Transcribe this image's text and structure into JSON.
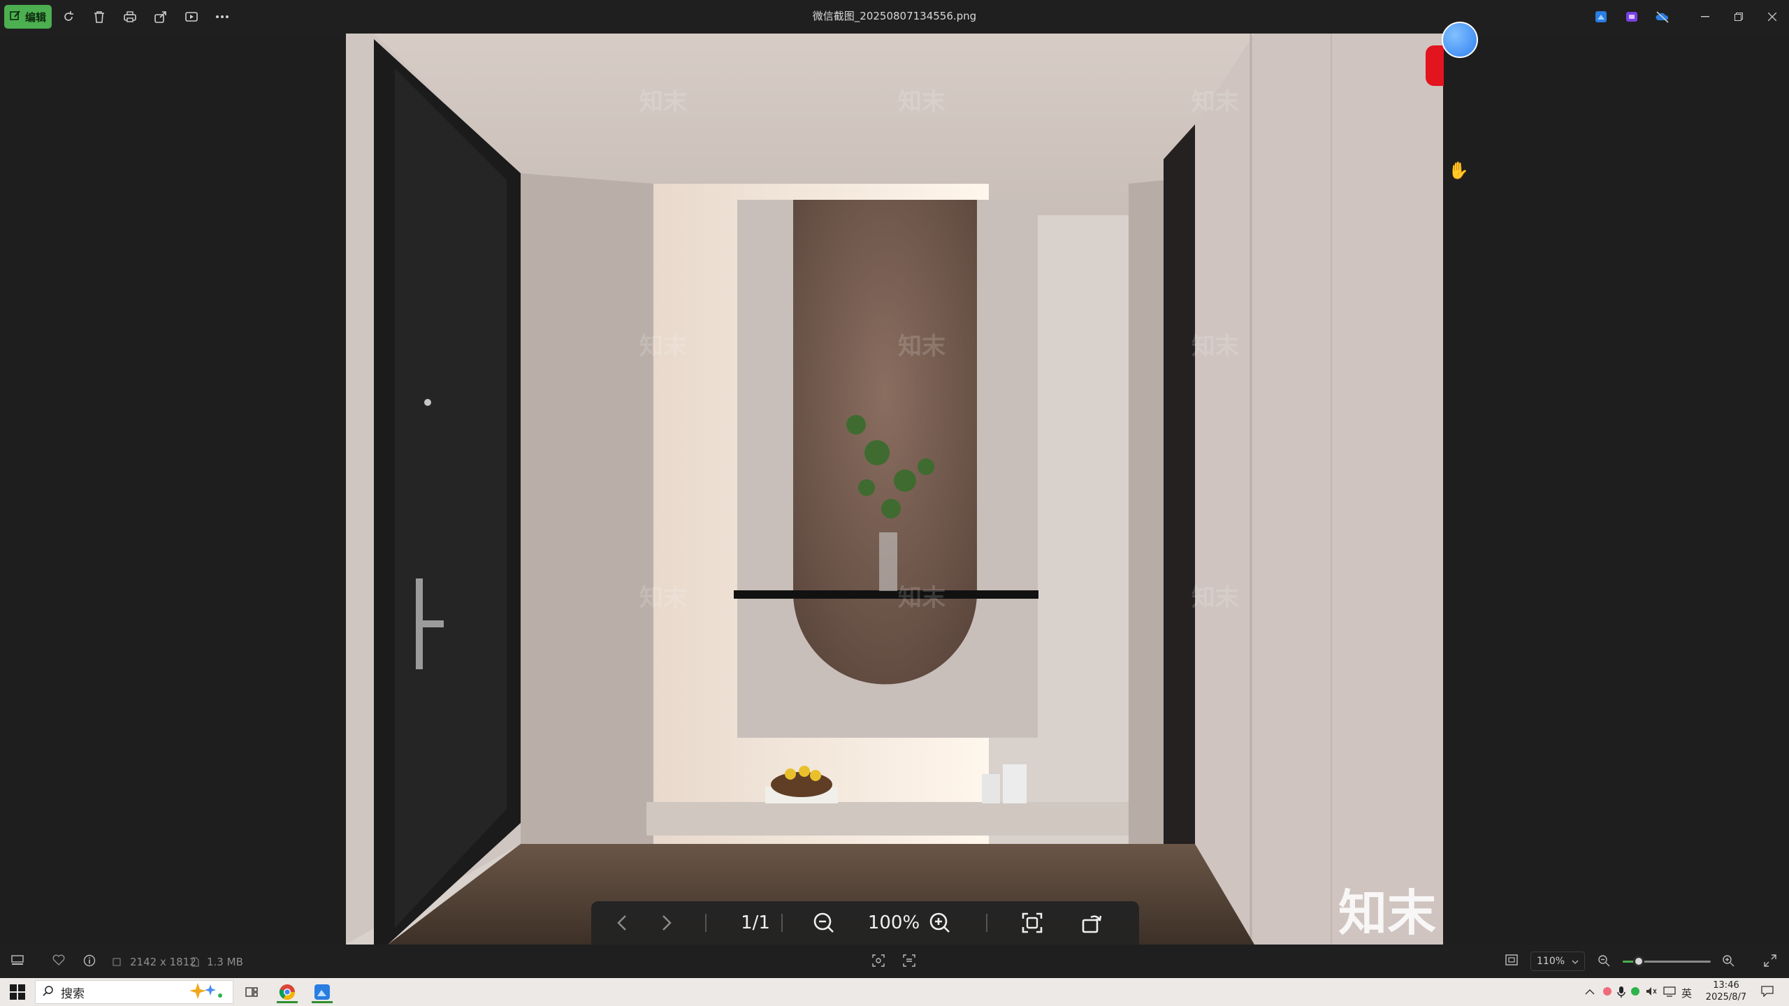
{
  "toolbar": {
    "edit_label": "编辑",
    "icons": [
      "rotate-icon",
      "delete-icon",
      "print-icon",
      "share-icon",
      "slideshow-icon",
      "more-icon"
    ],
    "title": "微信截图_20250807134556.png"
  },
  "photo": {
    "watermark_text": "知末"
  },
  "viewer": {
    "page_indicator": "1/1",
    "zoom": "100%"
  },
  "status": {
    "dimensions": "2142 x 1812",
    "file_size": "1.3 MB",
    "zoom_value": "110%",
    "zoom_slider_fraction": 0.18
  },
  "taskbar": {
    "search_placeholder": "搜索",
    "ime": "英",
    "time": "13:46",
    "date": "2025/8/7"
  },
  "colors": {
    "edit_button": "#4caf50",
    "background": "#1f1f1f",
    "taskbar": "#ece9e6"
  }
}
